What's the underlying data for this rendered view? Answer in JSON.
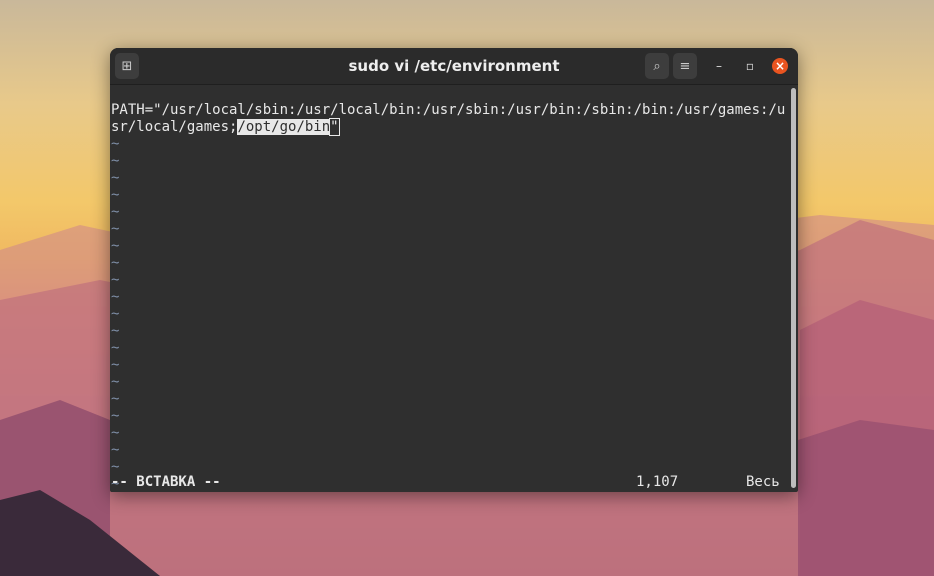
{
  "window": {
    "title": "sudo vi /etc/environment"
  },
  "icons": {
    "new_tab": "new-tab-icon",
    "search": "search-icon",
    "menu": "hamburger-menu-icon",
    "minimize": "minimize-icon",
    "maximize": "maximize-icon",
    "close": "close-icon"
  },
  "editor": {
    "line1": "PATH=\"/usr/local/sbin:/usr/local/bin:/usr/sbin:/usr/bin:/sbin:/bin:/usr/games:/u",
    "line2_pre": "sr/local/games;",
    "line2_sel": "/opt/go/bin",
    "line2_cursor": "\"",
    "tilde": "~",
    "mode": "-- ВСТАВКА --",
    "position": "1,107",
    "scroll": "Весь"
  },
  "colors": {
    "accent": "#e95420",
    "terminal_bg": "#2f2f2f"
  }
}
